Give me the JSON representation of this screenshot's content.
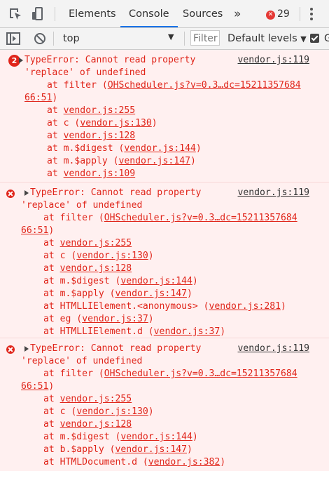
{
  "tabs": {
    "elements": "Elements",
    "console": "Console",
    "sources": "Sources",
    "more": "»",
    "error_badge": "29"
  },
  "toolbar": {
    "context": "top",
    "filter_placeholder": "Filter",
    "levels": "Default levels",
    "checkbox_label_fragment": "G"
  },
  "entries": [
    {
      "count": "2",
      "message": "TypeError: Cannot read property",
      "message_cont": "'replace' of undefined",
      "source": "vendor.js:119",
      "filter_frame": "OHScheduler.js?v=0.3…dc=15211357684",
      "filter_cont": "66:51",
      "frames": [
        {
          "prefix": "at ",
          "fn": "",
          "link": "vendor.js:255"
        },
        {
          "prefix": "at c (",
          "fn": "",
          "link": "vendor.js:130"
        },
        {
          "prefix": "at ",
          "fn": "",
          "link": "vendor.js:128"
        },
        {
          "prefix": "at m.$digest (",
          "fn": "",
          "link": "vendor.js:144"
        },
        {
          "prefix": "at m.$apply (",
          "fn": "",
          "link": "vendor.js:147"
        },
        {
          "prefix": "at ",
          "fn": "",
          "link": "vendor.js:109"
        }
      ]
    },
    {
      "count": "",
      "message": "TypeError: Cannot read property",
      "message_cont": "'replace' of undefined",
      "source": "vendor.js:119",
      "filter_frame": "OHScheduler.js?v=0.3…dc=15211357684",
      "filter_cont": "66:51",
      "frames": [
        {
          "prefix": "at ",
          "fn": "",
          "link": "vendor.js:255"
        },
        {
          "prefix": "at c (",
          "fn": "",
          "link": "vendor.js:130"
        },
        {
          "prefix": "at ",
          "fn": "",
          "link": "vendor.js:128"
        },
        {
          "prefix": "at m.$digest (",
          "fn": "",
          "link": "vendor.js:144"
        },
        {
          "prefix": "at m.$apply (",
          "fn": "",
          "link": "vendor.js:147"
        },
        {
          "prefix": "at HTMLLIElement.<anonymous> (",
          "fn": "",
          "link": "vendor.js:281"
        },
        {
          "prefix": "at eg (",
          "fn": "",
          "link": "vendor.js:37"
        },
        {
          "prefix": "at HTMLLIElement.d (",
          "fn": "",
          "link": "vendor.js:37"
        }
      ]
    },
    {
      "count": "",
      "message": "TypeError: Cannot read property",
      "message_cont": "'replace' of undefined",
      "source": "vendor.js:119",
      "filter_frame": "OHScheduler.js?v=0.3…dc=15211357684",
      "filter_cont": "66:51",
      "frames": [
        {
          "prefix": "at ",
          "fn": "",
          "link": "vendor.js:255"
        },
        {
          "prefix": "at c (",
          "fn": "",
          "link": "vendor.js:130"
        },
        {
          "prefix": "at ",
          "fn": "",
          "link": "vendor.js:128"
        },
        {
          "prefix": "at m.$digest (",
          "fn": "",
          "link": "vendor.js:144"
        },
        {
          "prefix": "at b.$apply (",
          "fn": "",
          "link": "vendor.js:147"
        },
        {
          "prefix": "at HTMLDocument.d (",
          "fn": "",
          "link": "vendor.js:382"
        }
      ]
    }
  ],
  "filter_prefix": "at filter (",
  "colors": {
    "error_text": "#e0251a",
    "error_bg": "#fff0f0",
    "active_tab": "#1a73e8"
  }
}
